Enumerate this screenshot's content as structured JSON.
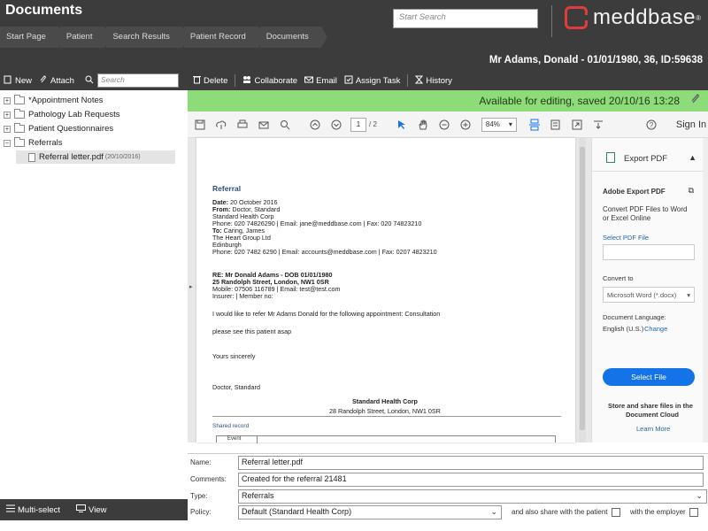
{
  "header": {
    "title": "Documents",
    "breadcrumbs": [
      "Start Page",
      "Patient",
      "Search Results",
      "Patient Record",
      "Documents"
    ],
    "search_placeholder": "Start Search",
    "logo_text": "meddbase",
    "logo_mark": "®"
  },
  "patient_bar": {
    "text": "Mr Adams, Donald - 01/01/1980, 36, ID:59638"
  },
  "left_toolbar": {
    "new": "New",
    "attach": "Attach",
    "search_placeholder": "Search"
  },
  "right_toolbar": {
    "delete": "Delete",
    "collaborate": "Collaborate",
    "email": "Email",
    "assign": "Assign Task",
    "history": "History"
  },
  "tree": {
    "items": [
      {
        "label": "*Appointment Notes"
      },
      {
        "label": "Pathology Lab Requests"
      },
      {
        "label": "Patient Questionnaires"
      },
      {
        "label": "Referrals"
      }
    ],
    "child": {
      "label": "Referral letter.pdf",
      "date": "(20/10/2016)"
    }
  },
  "left_footer": {
    "multiselect": "Multi-select",
    "view": "View"
  },
  "status": {
    "text": "Available for editing, saved 20/10/16 13:28",
    "color": "#8edb7a"
  },
  "pdf_toolbar": {
    "page": "1",
    "page_total": "/ 2",
    "zoom": "84%",
    "sign_in": "Sign In"
  },
  "pdf": {
    "title": "Referral",
    "lines": {
      "date_label": "Date:",
      "date_value": "20 October 2016",
      "from_label": "From:",
      "from_value": "Doctor, Standard",
      "from_org": "Standard Health Corp",
      "from_phone": "Phone: 020 74826290 | Email: jane@meddbase.com | Fax: 020 74823210",
      "to_label": "To:",
      "to_value": "Caring, James",
      "to_org": "The Heart Group Ltd",
      "to_city": "Edinburgh",
      "to_phone": "Phone: 020 7482 6290 | Email: accounts@meddbase.com | Fax: 0207 4823210",
      "re": "RE: Mr Donald Adams - DOB 01/01/1980",
      "address": "25 Randolph Street, London, NW1 0SR",
      "mobile": "Mobile: 07506 116789 | Email: test@test.com",
      "insurer": "Insurer: | Member no:",
      "body1": "I would like to refer Mr Adams Donald for the following appointment:  Consultation",
      "body2": "please see this patient asap",
      "closing": "Yours sincerely",
      "signature": "Doctor, Standard",
      "footer_org": "Standard Health Corp",
      "footer_addr": "28 Randolph Street, London, NW1 0SR",
      "shared": "Shared record",
      "event": "Event"
    }
  },
  "side_panel": {
    "export_pdf": "Export PDF",
    "adobe_title": "Adobe Export PDF",
    "desc1": "Convert PDF Files to Word",
    "desc2": "or Excel Online",
    "select_pdf": "Select PDF File",
    "convert_to": "Convert to",
    "format": "Microsoft Word (*.docx)",
    "doc_lang": "Document Language:",
    "lang": "English (U.S.)",
    "change": "Change",
    "select_file": "Select File",
    "store1": "Store and share files in the",
    "store2": "Document Cloud",
    "learn_more": "Learn More"
  },
  "form": {
    "name_label": "Name:",
    "name_value": "Referral letter.pdf",
    "comments_label": "Comments:",
    "comments_value": "Created for the referral 21481",
    "type_label": "Type:",
    "type_value": "Referrals",
    "policy_label": "Policy:",
    "policy_value": "Default (Standard Health Corp)",
    "share_patient": "and also share with the patient",
    "share_employer": "with the employer"
  }
}
